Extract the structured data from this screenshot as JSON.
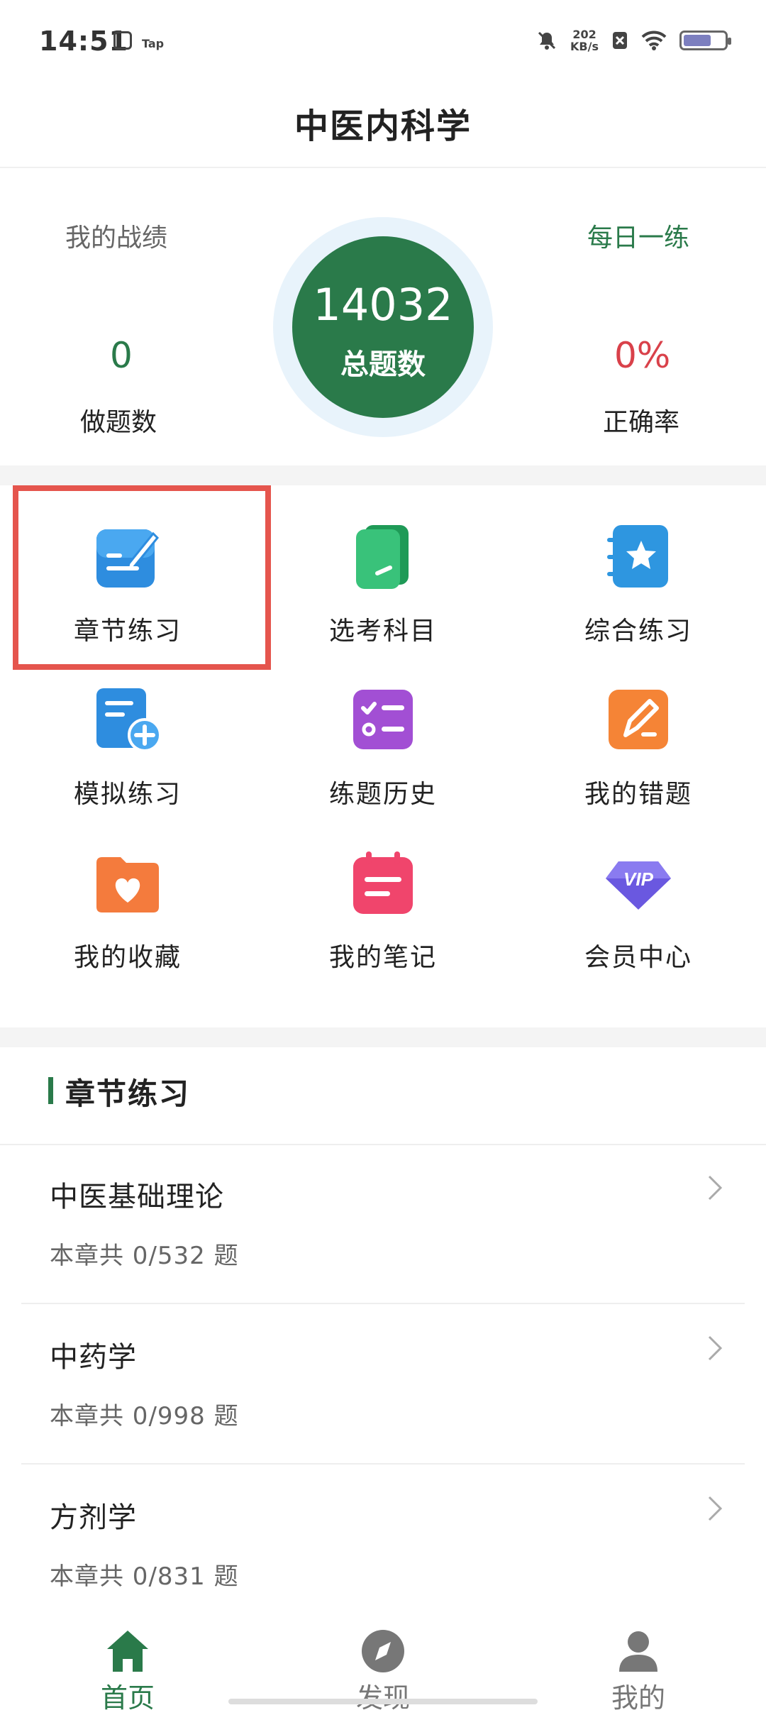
{
  "status_bar": {
    "time": "14:51",
    "tap_label": "Tap",
    "net_speed_value": "202",
    "net_speed_unit": "KB/s"
  },
  "header": {
    "title": "中医内科学"
  },
  "stats": {
    "my_record_label": "我的战绩",
    "daily_practice_label": "每日一练",
    "done_count": "0",
    "done_caption": "做题数",
    "total_count": "14032",
    "total_caption": "总题数",
    "accuracy": "0%",
    "accuracy_caption": "正确率",
    "colors": {
      "primary": "#2a7a4a",
      "accuracy": "#d9414a",
      "circle_halo": "#e8f3fb"
    }
  },
  "menu": [
    {
      "label": "章节练习",
      "icon": "chapter-practice-icon",
      "highlighted": true
    },
    {
      "label": "选考科目",
      "icon": "elective-subject-icon"
    },
    {
      "label": "综合练习",
      "icon": "comprehensive-practice-icon"
    },
    {
      "label": "模拟练习",
      "icon": "mock-practice-icon"
    },
    {
      "label": "练题历史",
      "icon": "practice-history-icon"
    },
    {
      "label": "我的错题",
      "icon": "wrong-questions-icon"
    },
    {
      "label": "我的收藏",
      "icon": "favorites-icon"
    },
    {
      "label": "我的笔记",
      "icon": "notes-icon"
    },
    {
      "label": "会员中心",
      "icon": "vip-icon",
      "badge": "VIP"
    }
  ],
  "chapter_section": {
    "title": "章节练习",
    "items": [
      {
        "name": "中医基础理论",
        "count": "本章共 0/532 题"
      },
      {
        "name": "中药学",
        "count": "本章共 0/998 题"
      },
      {
        "name": "方剂学",
        "count": "本章共 0/831 题"
      }
    ]
  },
  "bottom_nav": {
    "items": [
      {
        "label": "首页",
        "icon": "home-icon",
        "active": true
      },
      {
        "label": "发现",
        "icon": "discover-icon",
        "active": false
      },
      {
        "label": "我的",
        "icon": "profile-icon",
        "active": false
      }
    ],
    "active_color": "#2a7a4a",
    "inactive_color": "#777777"
  }
}
